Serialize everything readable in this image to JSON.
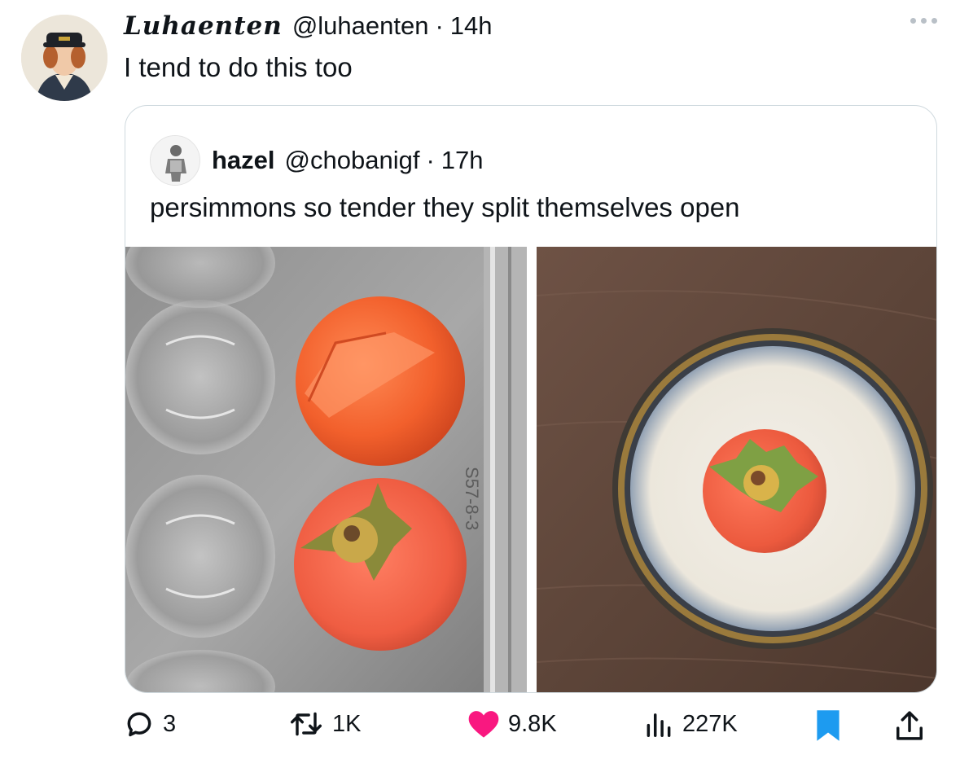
{
  "tweet": {
    "display_name": "Luhaenten",
    "handle": "@luhaenten",
    "separator": "·",
    "time": "14h",
    "text": "I tend to do this too"
  },
  "quote": {
    "display_name": "hazel",
    "handle": "@chobanigf",
    "separator": "·",
    "time": "17h",
    "text": "persimmons so tender they split themselves open",
    "images": [
      {
        "description_icon": "persimmons-in-clear-plastic-tray-photo",
        "tray_label": "S57-8-3"
      },
      {
        "description_icon": "persimmon-in-ceramic-bowl-photo"
      }
    ]
  },
  "actions": {
    "replies": "3",
    "reposts": "1K",
    "likes": "9.8K",
    "views": "227K"
  },
  "colors": {
    "like": "#f91880",
    "bookmark": "#1d9bf0",
    "text": "#0f1419",
    "border": "#cfd9de"
  }
}
